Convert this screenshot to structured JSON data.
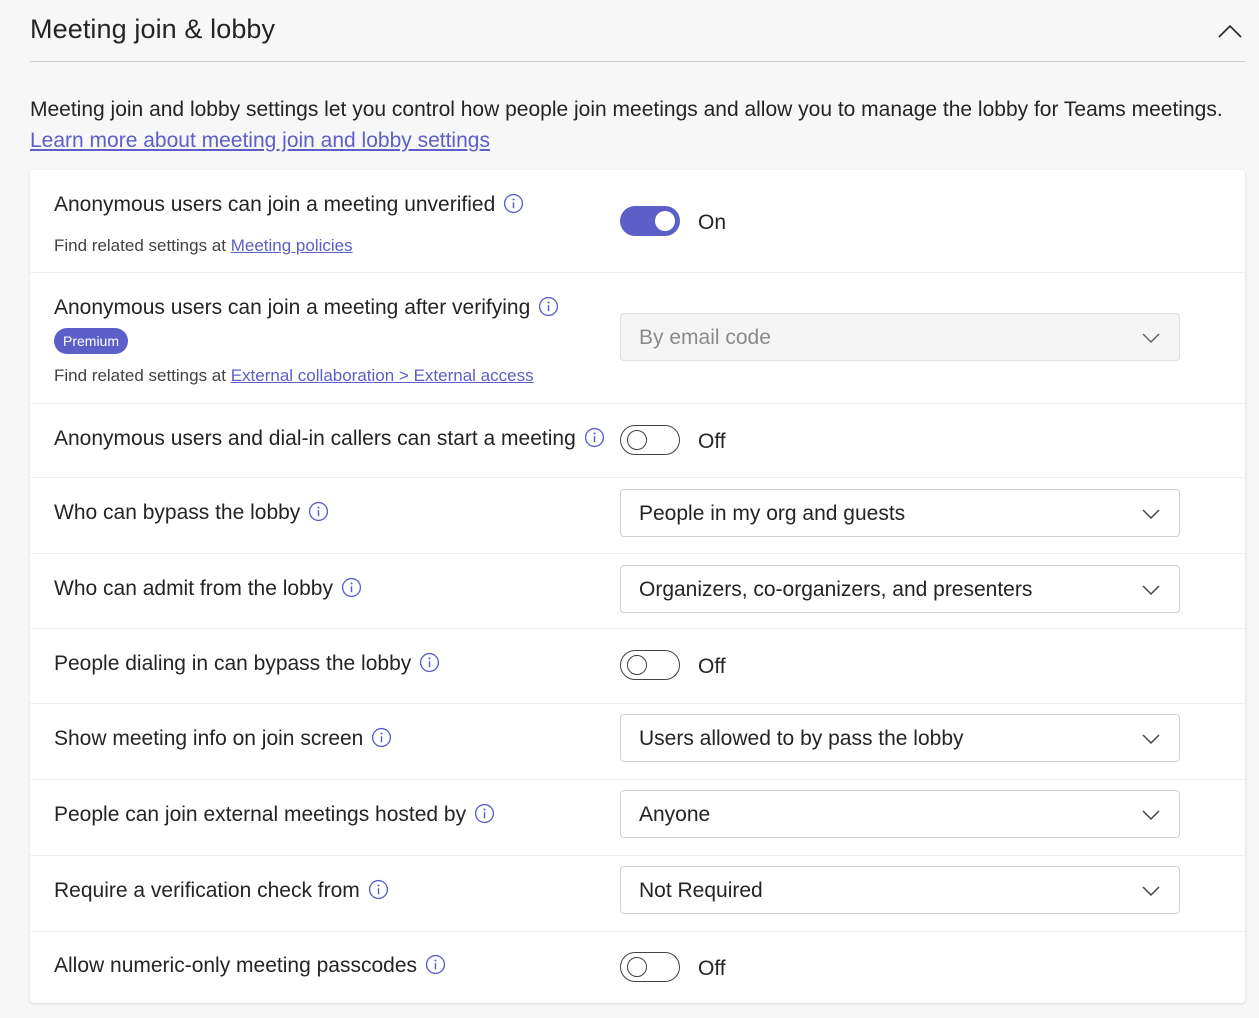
{
  "section": {
    "title": "Meeting join & lobby",
    "description": "Meeting join and lobby settings let you control how people join meetings and allow you to manage the lobby for Teams meetings.",
    "learn_more": "Learn more about meeting join and lobby settings"
  },
  "icons": {
    "collapse": "chevron-up-icon",
    "info": "info-icon",
    "dropdown": "chevron-down-icon"
  },
  "colors": {
    "accent": "#5b5fc7",
    "text": "#242424",
    "link": "#5b5fc7"
  },
  "settings": [
    {
      "label": "Anonymous users can join a meeting unverified",
      "control": "toggle",
      "state": "on",
      "value_text": "On",
      "related_prefix": "Find related settings at ",
      "related_link": "Meeting policies"
    },
    {
      "label": "Anonymous users can join a meeting after verifying",
      "badge": "Premium",
      "control": "dropdown",
      "disabled": true,
      "value": "By email code",
      "related_prefix": "Find related settings at ",
      "related_link": "External collaboration > External access"
    },
    {
      "label": "Anonymous users and dial-in callers can start a meeting",
      "control": "toggle",
      "state": "off",
      "value_text": "Off"
    },
    {
      "label": "Who can bypass the lobby",
      "control": "dropdown",
      "value": "People in my org and guests"
    },
    {
      "label": "Who can admit from the lobby",
      "control": "dropdown",
      "value": "Organizers, co-organizers, and presenters"
    },
    {
      "label": "People dialing in can bypass the lobby",
      "control": "toggle",
      "state": "off",
      "value_text": "Off"
    },
    {
      "label": "Show meeting info on join screen",
      "control": "dropdown",
      "value": "Users allowed to by pass the lobby"
    },
    {
      "label": "People can join external meetings hosted by",
      "control": "dropdown",
      "value": "Anyone"
    },
    {
      "label": "Require a verification check from",
      "control": "dropdown",
      "value": "Not Required"
    },
    {
      "label": "Allow numeric-only meeting passcodes",
      "control": "toggle",
      "state": "off",
      "value_text": "Off"
    }
  ]
}
